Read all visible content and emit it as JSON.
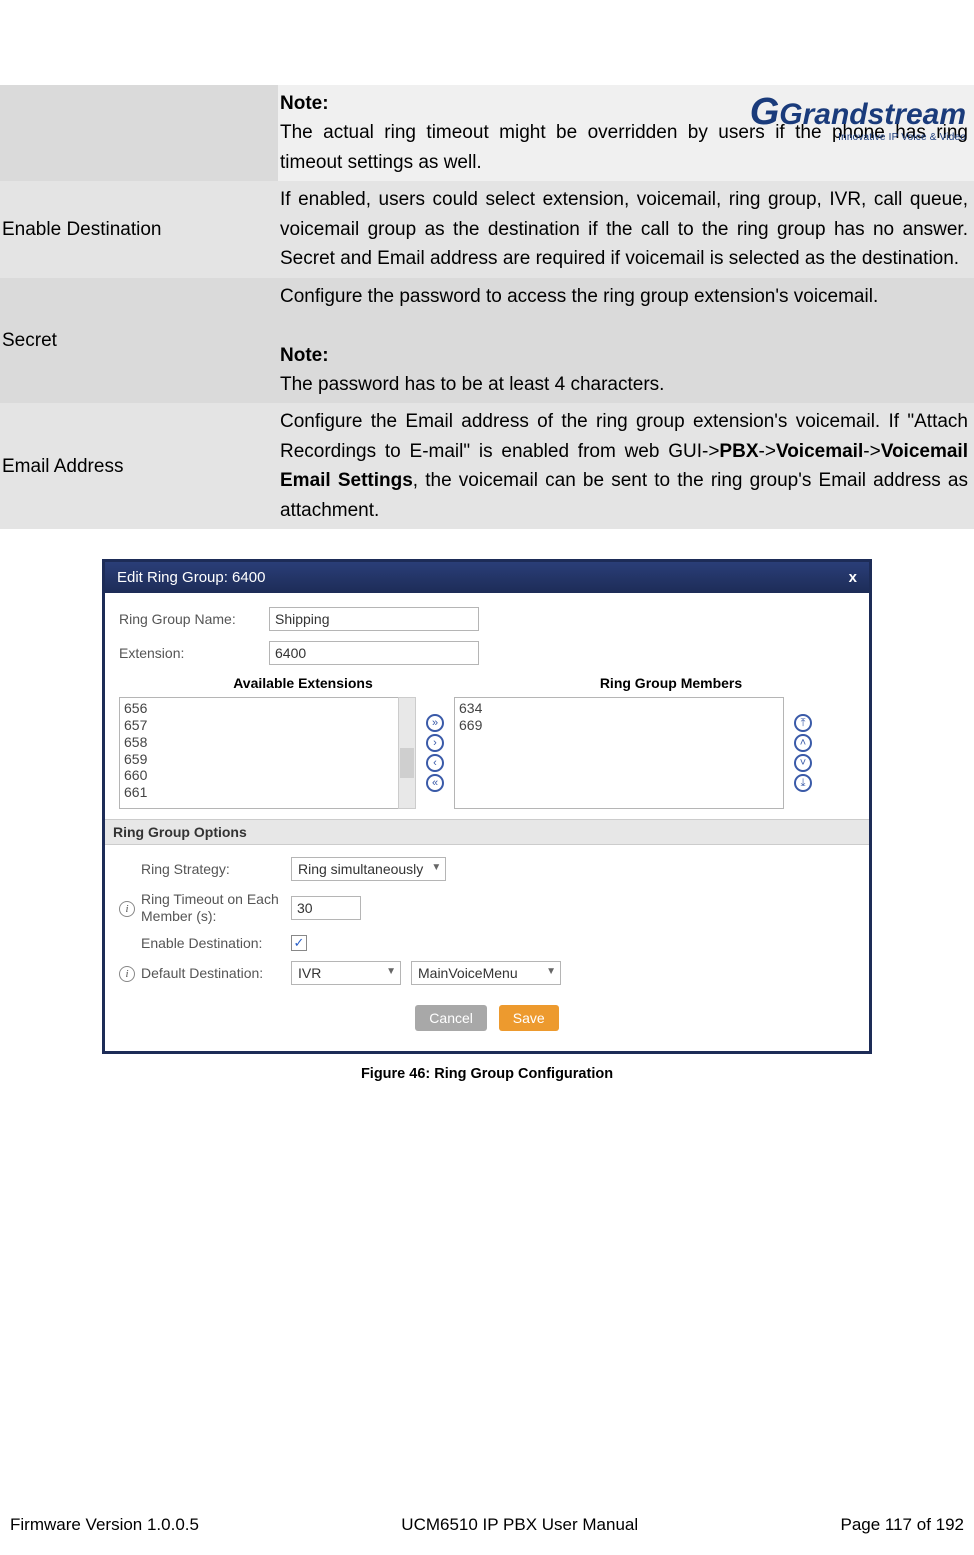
{
  "brand": {
    "name": "Grandstream",
    "tag": "Innovative IP Voice & Video"
  },
  "table": {
    "row0": {
      "note_label": "Note:",
      "note_text": "The actual ring timeout might be overridden by users if the phone has ring timeout settings as well."
    },
    "row1": {
      "label": "Enable Destination",
      "text": "If enabled, users could select extension, voicemail, ring group, IVR, call queue, voicemail group as the destination if the call to the ring group has no answer. Secret and Email address are required if voicemail is selected as the destination."
    },
    "row2": {
      "label": "Secret",
      "text1": "Configure the password to access the ring group extension's voicemail.",
      "note_label": "Note:",
      "note_text": "The password has to be at least 4 characters."
    },
    "row3": {
      "label": "Email Address",
      "text_pre": "Configure the Email address of the ring group extension's voicemail. If \"Attach Recordings to E-mail\" is enabled from web GUI->",
      "b1": "PBX",
      "sep1": "->",
      "b2": "Voicemail",
      "sep2": "->",
      "b3": "Voicemail Email Settings",
      "text_post": ", the voicemail can be sent to the ring group's Email address as attachment."
    }
  },
  "figure": {
    "title": "Edit Ring Group: 6400",
    "close": "x",
    "labels": {
      "name": "Ring Group Name:",
      "ext": "Extension:",
      "avail": "Available Extensions",
      "members": "Ring Group Members",
      "options": "Ring Group Options",
      "strategy": "Ring Strategy:",
      "timeout": "Ring Timeout on Each Member (s):",
      "enable_dest": "Enable Destination:",
      "default_dest": "Default Destination:"
    },
    "values": {
      "name": "Shipping",
      "ext": "6400",
      "avail_list": [
        "656",
        "657",
        "658",
        "659",
        "660",
        "661"
      ],
      "members_list": [
        "634",
        "669"
      ],
      "strategy": "Ring simultaneously",
      "timeout": "30",
      "dest_type": "IVR",
      "dest_target": "MainVoiceMenu"
    },
    "buttons": {
      "cancel": "Cancel",
      "save": "Save"
    },
    "caption": "Figure 46: Ring Group Configuration",
    "checkmark": "✓"
  },
  "footer": {
    "left": "Firmware Version 1.0.0.5",
    "center": "UCM6510 IP PBX User Manual",
    "right": "Page 117 of 192"
  },
  "glyph": {
    "i": "i",
    "r": "›",
    "l": "‹",
    "rr": "»",
    "ll": "«",
    "up": "˄",
    "dn": "˅"
  }
}
